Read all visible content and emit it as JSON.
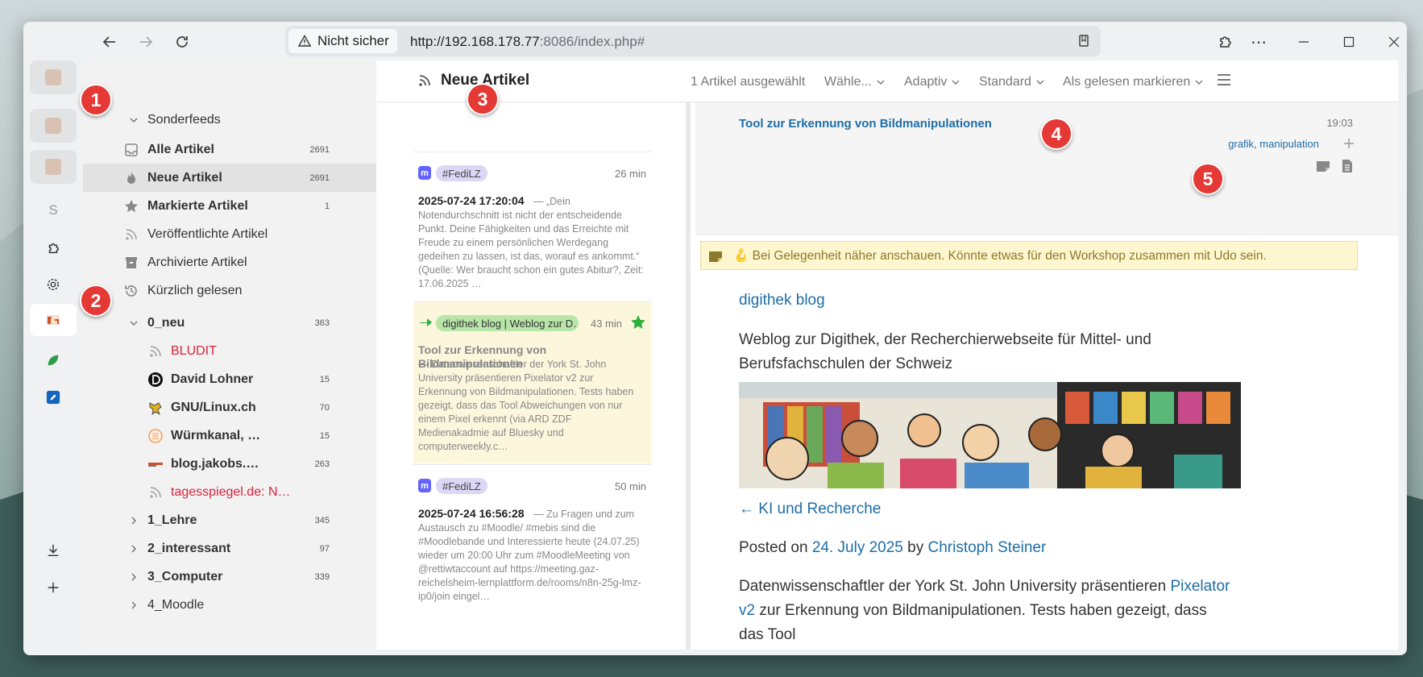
{
  "browser": {
    "security_label": "Nicht sicher",
    "url_host": "http://192.168.178.77",
    "url_rest": ":8086/index.php#"
  },
  "vertical_tabs": {
    "s_label": "S"
  },
  "annotations": [
    "1",
    "2",
    "3",
    "4",
    "5"
  ],
  "sidebar": {
    "special_header": "Sonderfeeds",
    "special_items": [
      {
        "label": "Alle Artikel",
        "count": "2691"
      },
      {
        "label": "Neue Artikel",
        "count": "2691"
      },
      {
        "label": "Markierte Artikel",
        "count": "1"
      },
      {
        "label": "Veröffentlichte Artikel",
        "count": ""
      },
      {
        "label": "Archivierte Artikel",
        "count": ""
      },
      {
        "label": "Kürzlich gelesen",
        "count": ""
      }
    ],
    "categories": [
      {
        "label": "0_neu",
        "count": "363"
      },
      {
        "label": "1_Lehre",
        "count": "345"
      },
      {
        "label": "2_interessant",
        "count": "97"
      },
      {
        "label": "3_Computer",
        "count": "339"
      },
      {
        "label": "4_Moodle",
        "count": ""
      }
    ],
    "feeds": [
      {
        "label": "BLUDIT",
        "count": ""
      },
      {
        "label": "David Lohner",
        "count": "15"
      },
      {
        "label": "GNU/Linux.ch",
        "count": "70"
      },
      {
        "label": "Würmkanal, …",
        "count": "15"
      },
      {
        "label": "blog.jakobs.…",
        "count": "263"
      },
      {
        "label": "tagesspiegel.de: N…",
        "count": ""
      }
    ]
  },
  "toolbar": {
    "title": "Neue Artikel",
    "selected": "1 Artikel ausgewählt",
    "select_menu": "Wähle...",
    "view_mode": "Adaptiv",
    "sort": "Standard",
    "mark_read": "Als gelesen markieren"
  },
  "articles": [
    {
      "tag": "#FediLZ",
      "time": "26 min",
      "title": "2025-07-24 17:20:04",
      "excerpt": " — „Dein Notendurchschnitt ist nicht der entscheidende Punkt. Deine Fähigkeiten und das Erreichte mit Freude zu einem persönlichen Werdegang gedeihen zu lassen, ist das, worauf es ankommt.“ (Quelle: Wer braucht schon ein gutes Abitur?, Zeit: 17.06.2025 …"
    },
    {
      "tag": "digithek blog | Weblog zur D…",
      "time": "43 min",
      "title": "Tool zur Erkennung von Bildmanipulationen",
      "excerpt": " — Datenwissenschaftler der York St. John University präsentieren Pixelator v2 zur Erkennung von Bildmanipulationen. Tests haben gezeigt, dass das Tool Abweichungen von nur einem Pixel erkennt (via ARD ZDF Medienakadmie auf Bluesky und computerweekly.c…"
    },
    {
      "tag": "#FediLZ",
      "time": "50 min",
      "title": "2025-07-24 16:56:28",
      "excerpt": " — Zu Fragen und zum Austausch zu #Moodle/ #mebis sind die #Moodlebande und Interessierte heute (24.07.25) wieder um 20:00 Uhr zum #MoodleMeeting von @rettiwtaccount auf https://meeting.gaz-reichelsheim-lernplattform.de/rooms/n8n-25g-lmz-ip0/join eingel…"
    }
  ],
  "article": {
    "title": "Tool zur Erkennung von Bildmanipulationen",
    "time": "19:03",
    "tags": "grafik, manipulation",
    "note": "🪝 Bei Gelegenheit näher anschauen. Könnte etwas für den Workshop zusammen mit Udo sein.",
    "blog_link": "digithek blog",
    "blog_desc": "Weblog zur Digithek, der Recherchierwebseite für Mittel- und Berufsfachschulen der Schweiz",
    "prev_link": "← KI und Recherche",
    "posted_on": "Posted on ",
    "posted_date": "24. July 2025",
    "posted_by": " by ",
    "author": "Christoph Steiner",
    "para_start": "Datenwissenschaftler der York St. John University präsentieren ",
    "para_link": "Pixelator v2",
    "para_end": " zur Erkennung von Bildmanipulationen. Tests haben gezeigt, dass das Tool"
  },
  "colors": {
    "accent_link": "#1e6ea7",
    "badge_red": "#e53935",
    "selected_card": "#fbf6dc",
    "tag_green": "#b8e6a8",
    "tag_purple": "#dcd7f5"
  }
}
